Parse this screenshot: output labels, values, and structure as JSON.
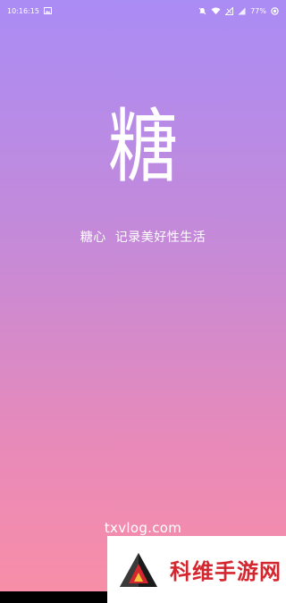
{
  "statusbar": {
    "time": "10:16:15",
    "battery": "77%"
  },
  "splash": {
    "logo_char": "糖",
    "app_name": "糖心",
    "slogan": "记录美好性生活",
    "website": "txvlog.com"
  },
  "watermark": {
    "text": "科维手游网"
  },
  "colors": {
    "gradient_top": "#aa8cf5",
    "gradient_bottom": "#f98ea6",
    "watermark_red": "#d4262e"
  }
}
